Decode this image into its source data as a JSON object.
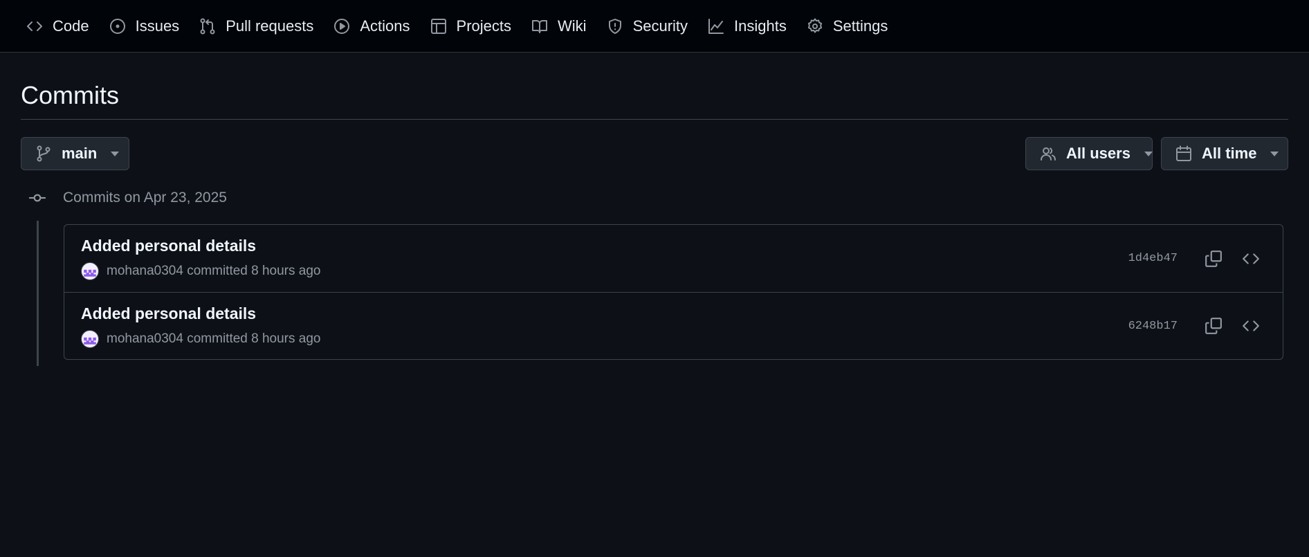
{
  "nav": {
    "items": [
      {
        "label": "Code",
        "icon": "code-icon"
      },
      {
        "label": "Issues",
        "icon": "issue-icon"
      },
      {
        "label": "Pull requests",
        "icon": "pull-request-icon"
      },
      {
        "label": "Actions",
        "icon": "play-icon"
      },
      {
        "label": "Projects",
        "icon": "table-icon"
      },
      {
        "label": "Wiki",
        "icon": "book-icon"
      },
      {
        "label": "Security",
        "icon": "shield-icon"
      },
      {
        "label": "Insights",
        "icon": "graph-icon"
      },
      {
        "label": "Settings",
        "icon": "gear-icon"
      }
    ]
  },
  "page": {
    "title": "Commits"
  },
  "filters": {
    "branch": "main",
    "users": "All users",
    "time": "All time"
  },
  "groups": [
    {
      "label": "Commits on Apr 23, 2025",
      "commits": [
        {
          "title": "Added personal details",
          "author": "mohana0304",
          "action": "committed 8 hours ago",
          "sha": "1d4eb47"
        },
        {
          "title": "Added personal details",
          "author": "mohana0304",
          "action": "committed 8 hours ago",
          "sha": "6248b17"
        }
      ]
    }
  ],
  "colors": {
    "background": "#0d1117",
    "nav_background": "#010409",
    "border": "#3d444d",
    "muted_text": "#9198a1",
    "avatar_accent": "#8c5ae8"
  }
}
